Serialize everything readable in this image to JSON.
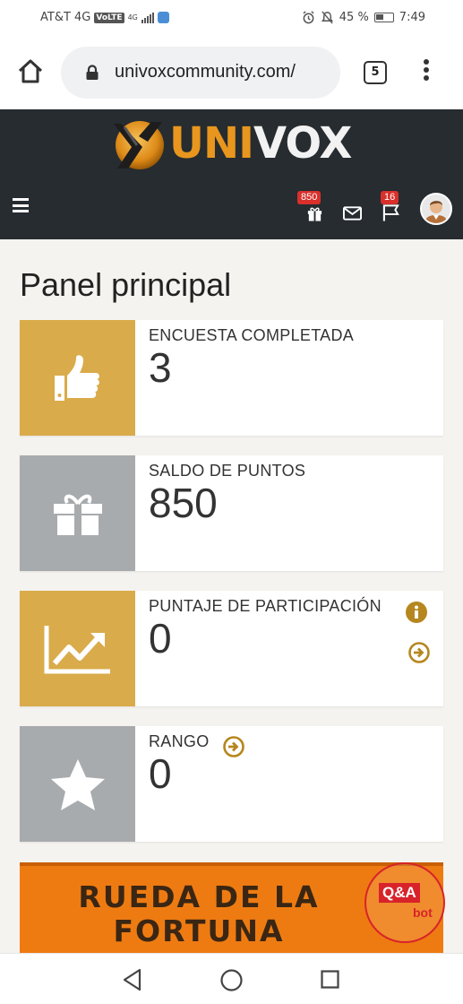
{
  "status_bar": {
    "carrier": "AT&T 4G",
    "volte": "VoLTE",
    "network": "4G",
    "battery": "45 %",
    "time": "7:49"
  },
  "browser": {
    "url": "univoxcommunity.com/",
    "tab_count": "5"
  },
  "site": {
    "logo_text_accent": "UNI",
    "logo_text_main": "VOX",
    "points_badge": "850",
    "flag_badge": "16"
  },
  "page": {
    "title": "Panel principal"
  },
  "cards": [
    {
      "label": "ENCUESTA COMPLETADA",
      "value": "3",
      "icon": "thumbs-up-icon",
      "color": "#d9ab4a"
    },
    {
      "label": "SALDO DE PUNTOS",
      "value": "850",
      "icon": "gift-icon",
      "color": "#a8abae"
    },
    {
      "label": "PUNTAJE DE PARTICIPACIÓN",
      "value": "0",
      "icon": "trend-up-icon",
      "color": "#d9ab4a"
    },
    {
      "label": "RANGO",
      "value": "0",
      "icon": "star-icon",
      "color": "#a8abae"
    }
  ],
  "banner": {
    "line1": "RUEDA DE LA",
    "line2": "FORTUNA"
  },
  "qa_bot": {
    "title": "Q&A",
    "sub": "bot"
  },
  "colors": {
    "accent_gold": "#d9ab4a",
    "header_dark": "#262c30",
    "banner_orange": "#ee7b12",
    "badge_red": "#d9302c"
  }
}
